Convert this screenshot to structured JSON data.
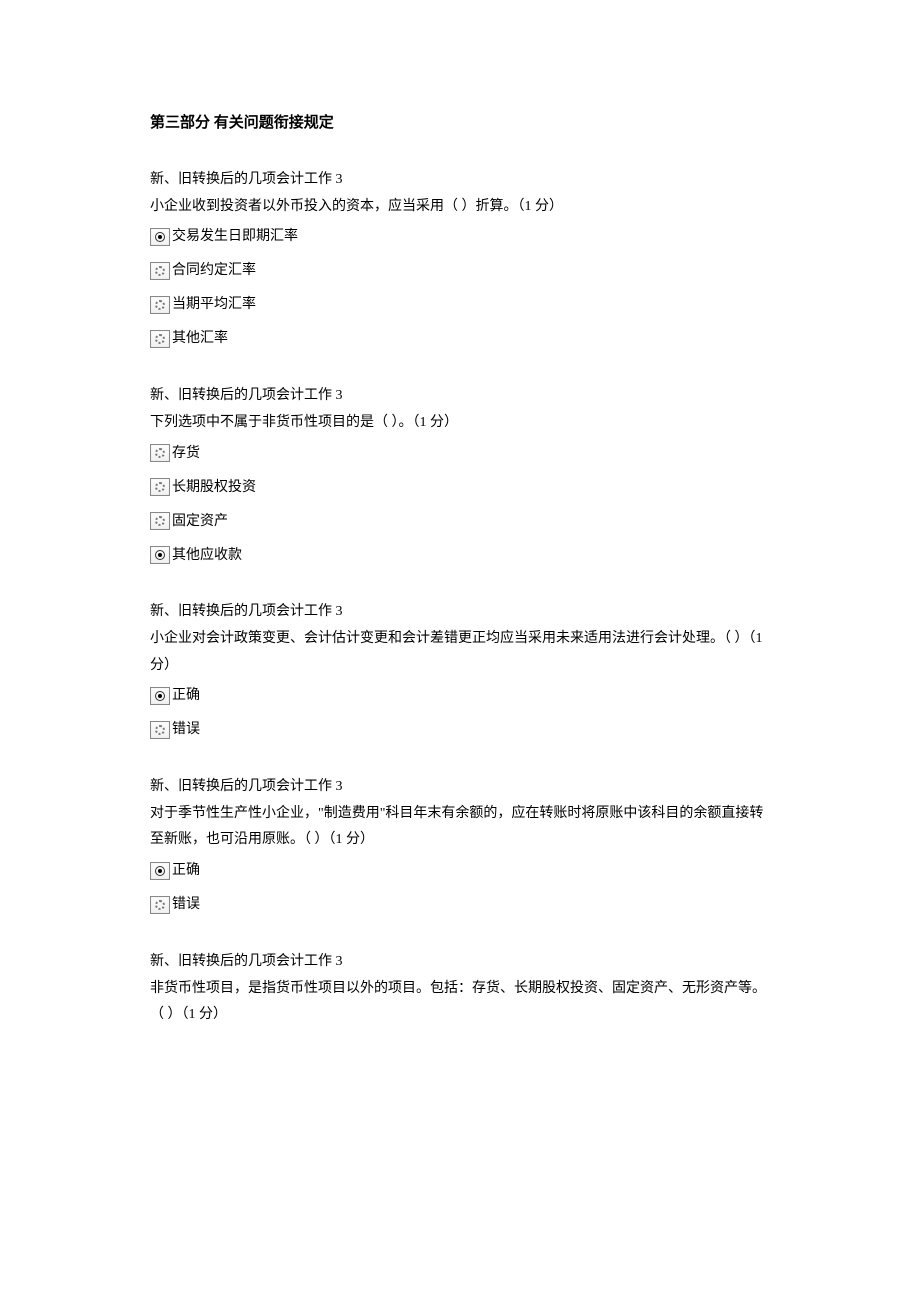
{
  "section_title": "第三部分 有关问题衔接规定",
  "questions": [
    {
      "header": "新、旧转换后的几项会计工作 3",
      "text": "小企业收到投资者以外币投入的资本，应当采用（    ）折算。（1 分）",
      "options": [
        {
          "label": "交易发生日即期汇率",
          "selected": true
        },
        {
          "label": "合同约定汇率",
          "selected": false
        },
        {
          "label": "当期平均汇率",
          "selected": false
        },
        {
          "label": "其他汇率",
          "selected": false
        }
      ]
    },
    {
      "header": "新、旧转换后的几项会计工作 3",
      "text": "下列选项中不属于非货币性项目的是（  ）。（1 分）",
      "options": [
        {
          "label": "存货",
          "selected": false
        },
        {
          "label": "长期股权投资",
          "selected": false
        },
        {
          "label": "固定资产",
          "selected": false
        },
        {
          "label": "其他应收款",
          "selected": true
        }
      ]
    },
    {
      "header": "新、旧转换后的几项会计工作 3",
      "text": "小企业对会计政策变更、会计估计变更和会计差错更正均应当采用未来适用法进行会计处理。（  ）（1 分）",
      "options": [
        {
          "label": "正确",
          "selected": true
        },
        {
          "label": "错误",
          "selected": false
        }
      ]
    },
    {
      "header": "新、旧转换后的几项会计工作 3",
      "text": "对于季节性生产性小企业，\"制造费用\"科目年末有余额的，应在转账时将原账中该科目的余额直接转至新账，也可沿用原账。（    ）（1 分）",
      "options": [
        {
          "label": "正确",
          "selected": true
        },
        {
          "label": "错误",
          "selected": false
        }
      ]
    },
    {
      "header": "新、旧转换后的几项会计工作 3",
      "text": "非货币性项目，是指货币性项目以外的项目。包括：存货、长期股权投资、固定资产、无形资产等。（    ）（1 分）",
      "options": []
    }
  ]
}
